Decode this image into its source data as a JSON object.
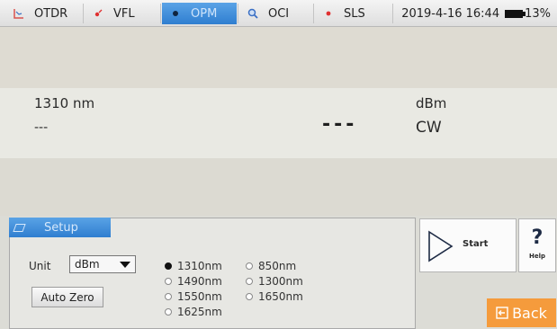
{
  "tabs": [
    {
      "label": "OTDR",
      "icon": "otdr-icon"
    },
    {
      "label": "VFL",
      "icon": "vfl-icon"
    },
    {
      "label": "OPM",
      "icon": "opm-icon",
      "active": true
    },
    {
      "label": "OCI",
      "icon": "oci-icon"
    },
    {
      "label": "SLS",
      "icon": "sls-icon"
    }
  ],
  "status": {
    "datetime": "2019-4-16 16:44",
    "battery": "13%"
  },
  "reading": {
    "wavelength": "1310 nm",
    "secondary": "---",
    "value": "---",
    "unit": "dBm",
    "mode": "CW"
  },
  "setup": {
    "tab_label": "Setup",
    "unit_label": "Unit",
    "unit_value": "dBm",
    "auto_zero_label": "Auto Zero",
    "wavelengths": [
      "1310nm",
      "850nm",
      "1490nm",
      "1300nm",
      "1550nm",
      "1650nm",
      "1625nm"
    ],
    "selected_wavelength": "1310nm"
  },
  "actions": {
    "start_label": "Start",
    "help_symbol": "?",
    "help_label": "Help",
    "back_label": "Back"
  },
  "colors": {
    "accent": "#2f7ed0",
    "back": "#f59b3c"
  }
}
